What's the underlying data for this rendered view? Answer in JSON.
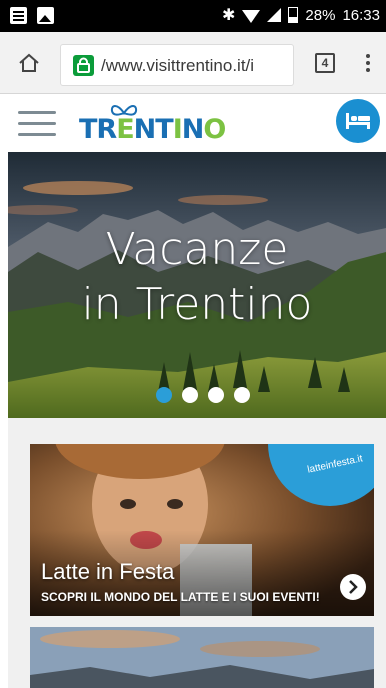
{
  "status_bar": {
    "battery": "28%",
    "time": "16:33"
  },
  "browser": {
    "url": "/www.visittrentino.it/i",
    "tab_count": "4"
  },
  "site": {
    "logo_text": "TRENTINO"
  },
  "hero": {
    "title_line1": "Vacanze",
    "title_line2": "in Trentino",
    "slide_count": 4,
    "active_slide": 1
  },
  "cards": [
    {
      "title": "Latte in Festa",
      "subtitle": "SCOPRI IL MONDO DEL LATTE E I SUOI EVENTI!",
      "badge": "latteinfesta.it"
    }
  ],
  "colors": {
    "accent": "#2b9ed8",
    "secure_green": "#0b9c3a",
    "logo_blue": "#1a6fb3",
    "logo_green": "#7cc242"
  }
}
